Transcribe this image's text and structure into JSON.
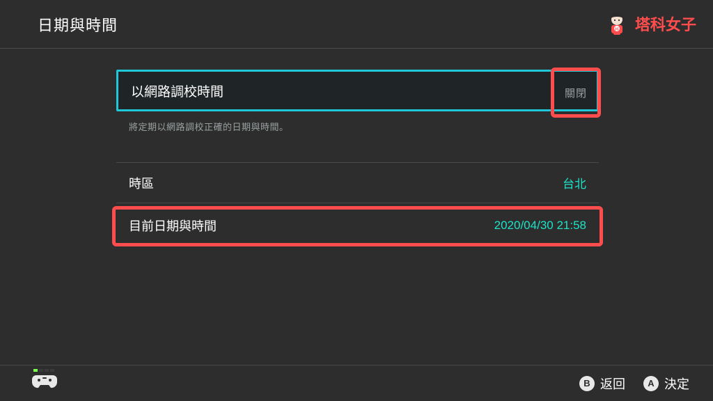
{
  "header": {
    "title": "日期與時間",
    "brand_name": "塔科女子"
  },
  "settings": {
    "sync_network": {
      "label": "以網路調校時間",
      "value": "關閉",
      "hint": "將定期以網路調校正確的日期與時間。"
    },
    "timezone": {
      "label": "時區",
      "value": "台北"
    },
    "current_datetime": {
      "label": "目前日期與時間",
      "value": "2020/04/30 21:58"
    }
  },
  "footer": {
    "back": {
      "glyph": "B",
      "label": "返回"
    },
    "confirm": {
      "glyph": "A",
      "label": "決定"
    }
  }
}
